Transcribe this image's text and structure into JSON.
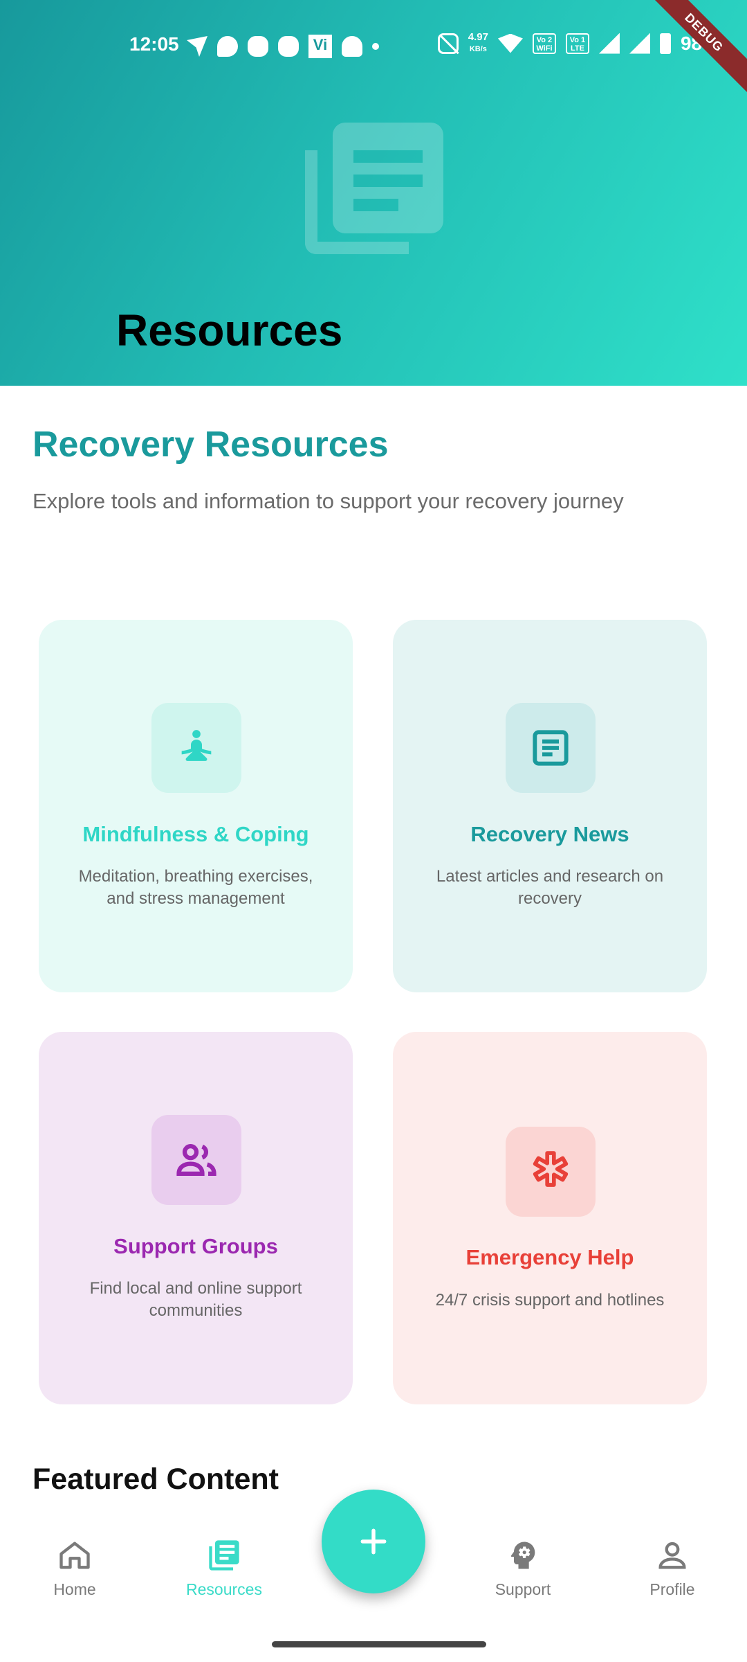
{
  "status_bar": {
    "time": "12:05",
    "net_speed_value": "4.97",
    "net_speed_unit": "KB/s",
    "battery": "98%",
    "volte_labels": [
      "Vo 2 WiFi",
      "Vo 1 LTE"
    ],
    "icons": [
      "send-icon",
      "chat-icon",
      "game-icon",
      "game-icon",
      "vi-icon",
      "bell-icon",
      "dot-icon",
      "mute-icon",
      "wifi-icon",
      "signal-icon",
      "battery-icon"
    ]
  },
  "debug_banner": "DEBUG",
  "header": {
    "title": "Resources",
    "icon": "newspaper-icon",
    "gradient": [
      "#17999c",
      "#2fe0c9"
    ]
  },
  "intro": {
    "title": "Recovery Resources",
    "subtitle": "Explore tools and information to support your recovery journey"
  },
  "cards": [
    {
      "title": "Mindfulness & Coping",
      "description": "Meditation, breathing exercises, and stress management",
      "icon": "meditation-icon",
      "color": "#2fd6c6"
    },
    {
      "title": "Recovery News",
      "description": "Latest articles and research on recovery",
      "icon": "article-icon",
      "color": "#1a9a9c"
    },
    {
      "title": "Support Groups",
      "description": "Find local and online support communities",
      "icon": "group-icon",
      "color": "#9b28b0"
    },
    {
      "title": "Emergency Help",
      "description": "24/7 crisis support and hotlines",
      "icon": "medical-asterisk-icon",
      "color": "#e84038"
    }
  ],
  "featured": {
    "title": "Featured Content"
  },
  "bottom_nav": {
    "items": [
      {
        "label": "Home",
        "icon": "home-icon",
        "active": false
      },
      {
        "label": "Resources",
        "icon": "newspaper-icon",
        "active": true
      },
      {
        "label": "Support",
        "icon": "psychology-icon",
        "active": false
      },
      {
        "label": "Profile",
        "icon": "person-icon",
        "active": false
      }
    ],
    "fab_icon": "plus-icon",
    "active_color": "#3adbc8"
  }
}
